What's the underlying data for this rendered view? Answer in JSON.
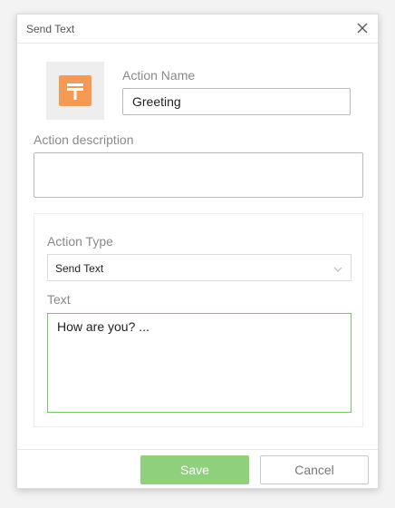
{
  "dialog": {
    "title": "Send Text",
    "close_icon": "close-icon"
  },
  "action_icon": {
    "icon": "text-action-icon",
    "color": "#f59a55"
  },
  "form": {
    "name_label": "Action Name",
    "name_value": "Greeting",
    "description_label": "Action description",
    "description_value": "",
    "type_label": "Action Type",
    "type_value": "Send Text",
    "text_label": "Text",
    "text_value": "How are you? ..."
  },
  "footer": {
    "save_label": "Save",
    "cancel_label": "Cancel",
    "save_color": "#8fd07d"
  }
}
